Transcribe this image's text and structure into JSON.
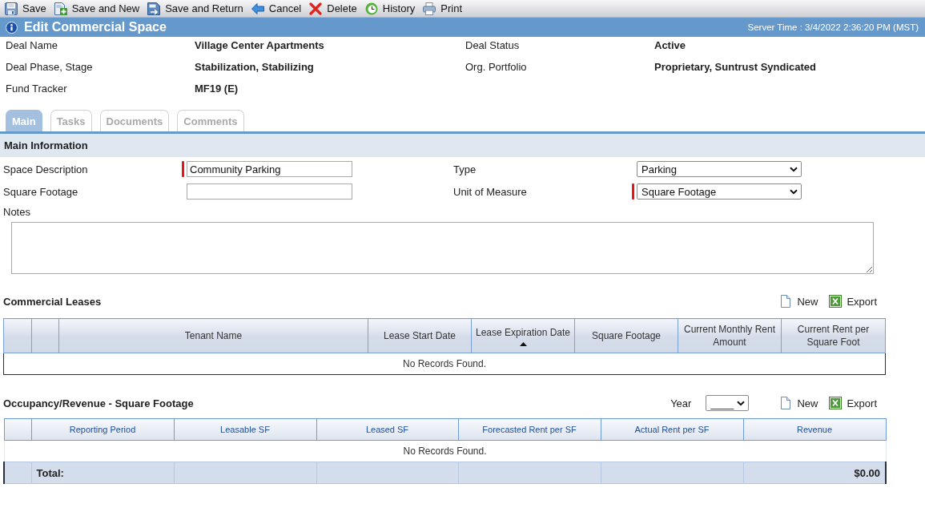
{
  "toolbar": [
    {
      "kind": "save",
      "label": "Save"
    },
    {
      "kind": "save_new",
      "label": "Save and New"
    },
    {
      "kind": "save_return",
      "label": "Save and Return"
    },
    {
      "kind": "cancel",
      "label": "Cancel"
    },
    {
      "kind": "delete",
      "label": "Delete"
    },
    {
      "kind": "history",
      "label": "History"
    },
    {
      "kind": "print",
      "label": "Print"
    }
  ],
  "page_header": {
    "title": "Edit Commercial Space",
    "server_time": "Server Time : 3/4/2022 2:36:20 PM (MST)"
  },
  "deal_info": [
    {
      "label": "Deal Name",
      "value": "Village Center Apartments"
    },
    {
      "label": "Deal Status",
      "value": "Active"
    },
    {
      "label": "Deal Phase, Stage",
      "value": "Stabilization, Stabilizing"
    },
    {
      "label": "Org. Portfolio",
      "value": "Proprietary, Suntrust Syndicated"
    },
    {
      "label": "Fund Tracker",
      "value": "MF19 (E)"
    }
  ],
  "tabs": [
    {
      "label": "Main",
      "selected": true
    },
    {
      "label": "Tasks",
      "selected": false
    },
    {
      "label": "Documents",
      "selected": false
    },
    {
      "label": "Comments",
      "selected": false
    }
  ],
  "main_information": {
    "title": "Main Information",
    "fields": [
      {
        "label": "Space Description",
        "kind": "text",
        "value": "Community Parking",
        "required": true
      },
      {
        "label": "Type",
        "kind": "select",
        "value": "Parking",
        "required": false
      },
      {
        "label": "Square Footage",
        "kind": "text",
        "required": false
      },
      {
        "label": "Unit of Measure",
        "kind": "select",
        "value": "Square Footage",
        "required": true
      }
    ],
    "notes": {
      "label": "Notes"
    }
  },
  "commercial_leases": {
    "title": "Commercial Leases",
    "actions": [
      {
        "kind": "new",
        "label": "New"
      },
      {
        "kind": "export",
        "label": "Export"
      }
    ],
    "columns": [
      {
        "label": "Tenant Name",
        "sorted": false
      },
      {
        "label": "Lease Start Date",
        "sorted": false
      },
      {
        "label": "Lease Expiration Date",
        "sorted": true
      },
      {
        "label": "Square Footage",
        "sorted": false
      },
      {
        "label": "Current Monthly Rent Amount",
        "sorted": false
      },
      {
        "label": "Current Rent per Square Foot",
        "sorted": false
      }
    ],
    "empty_message": "No Records Found."
  },
  "occupancy_revenue": {
    "title": "Occupancy/Revenue - Square Footage",
    "year": {
      "label": "Year",
      "value": "____"
    },
    "actions": [
      {
        "kind": "new",
        "label": "New"
      },
      {
        "kind": "export",
        "label": "Export"
      }
    ],
    "columns": [
      {
        "label": "Reporting Period"
      },
      {
        "label": "Leasable SF"
      },
      {
        "label": "Leased SF"
      },
      {
        "label": "Forecasted Rent per SF"
      },
      {
        "label": "Actual Rent per SF"
      },
      {
        "label": "Revenue"
      }
    ],
    "empty_message": "No Records Found.",
    "total": {
      "label": "Total:",
      "value": "$0.00"
    }
  }
}
